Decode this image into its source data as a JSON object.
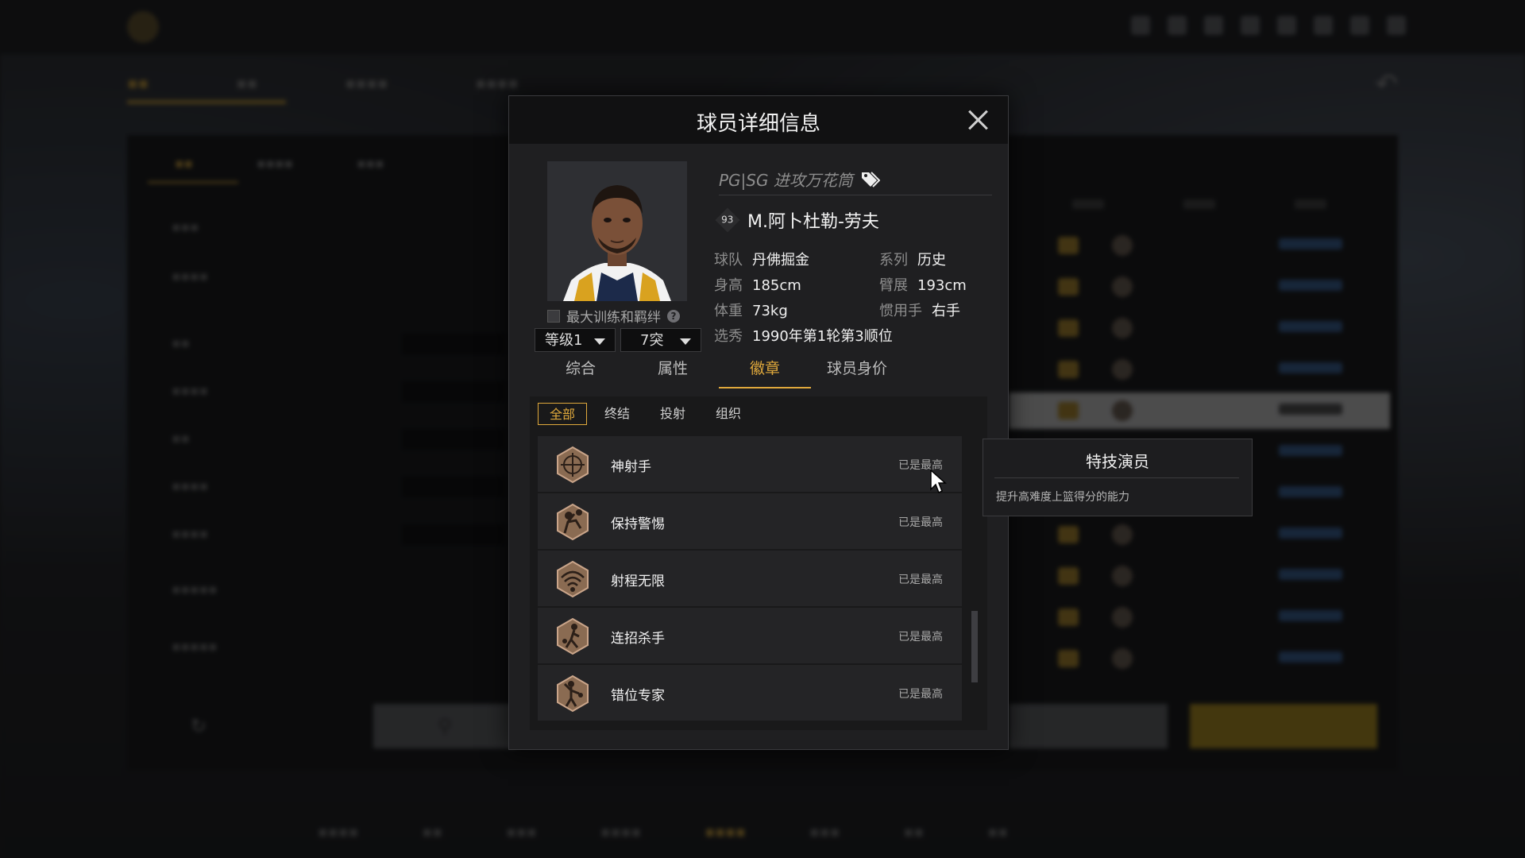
{
  "modal": {
    "title": "球员详细信息",
    "archetype": "PG|SG 进攻万花筒",
    "overall": "93",
    "player_name": "M.阿卜杜勒-劳夫",
    "info": {
      "team_label": "球队",
      "team": "丹佛掘金",
      "series_label": "系列",
      "series": "历史",
      "height_label": "身高",
      "height": "185cm",
      "wingspan_label": "臂展",
      "wingspan": "193cm",
      "weight_label": "体重",
      "weight": "73kg",
      "hand_label": "惯用手",
      "hand": "右手",
      "draft_label": "选秀",
      "draft": "1990年第1轮第3顺位"
    },
    "bond_label": "最大训练和羁绊",
    "level_select": "等级1",
    "breakthrough_select": "7突",
    "tabs": [
      "综合",
      "属性",
      "徽章",
      "球员身价"
    ],
    "active_tab": "徽章",
    "filters": [
      "全部",
      "终结",
      "投射",
      "组织"
    ],
    "active_filter": "全部",
    "badges": [
      {
        "name": "神射手",
        "level": "已是最高",
        "icon": "crosshair-icon"
      },
      {
        "name": "保持警惕",
        "level": "已是最高",
        "icon": "defender-icon"
      },
      {
        "name": "射程无限",
        "level": "已是最高",
        "icon": "range-icon"
      },
      {
        "name": "连招杀手",
        "level": "已是最高",
        "icon": "dribble-icon"
      },
      {
        "name": "错位专家",
        "level": "已是最高",
        "icon": "post-icon"
      }
    ]
  },
  "tooltip": {
    "title": "特技演员",
    "description": "提升高难度上篮得分的能力"
  },
  "colors": {
    "accent": "#e0a93c",
    "panel": "#1f1f21",
    "header": "#111112"
  }
}
